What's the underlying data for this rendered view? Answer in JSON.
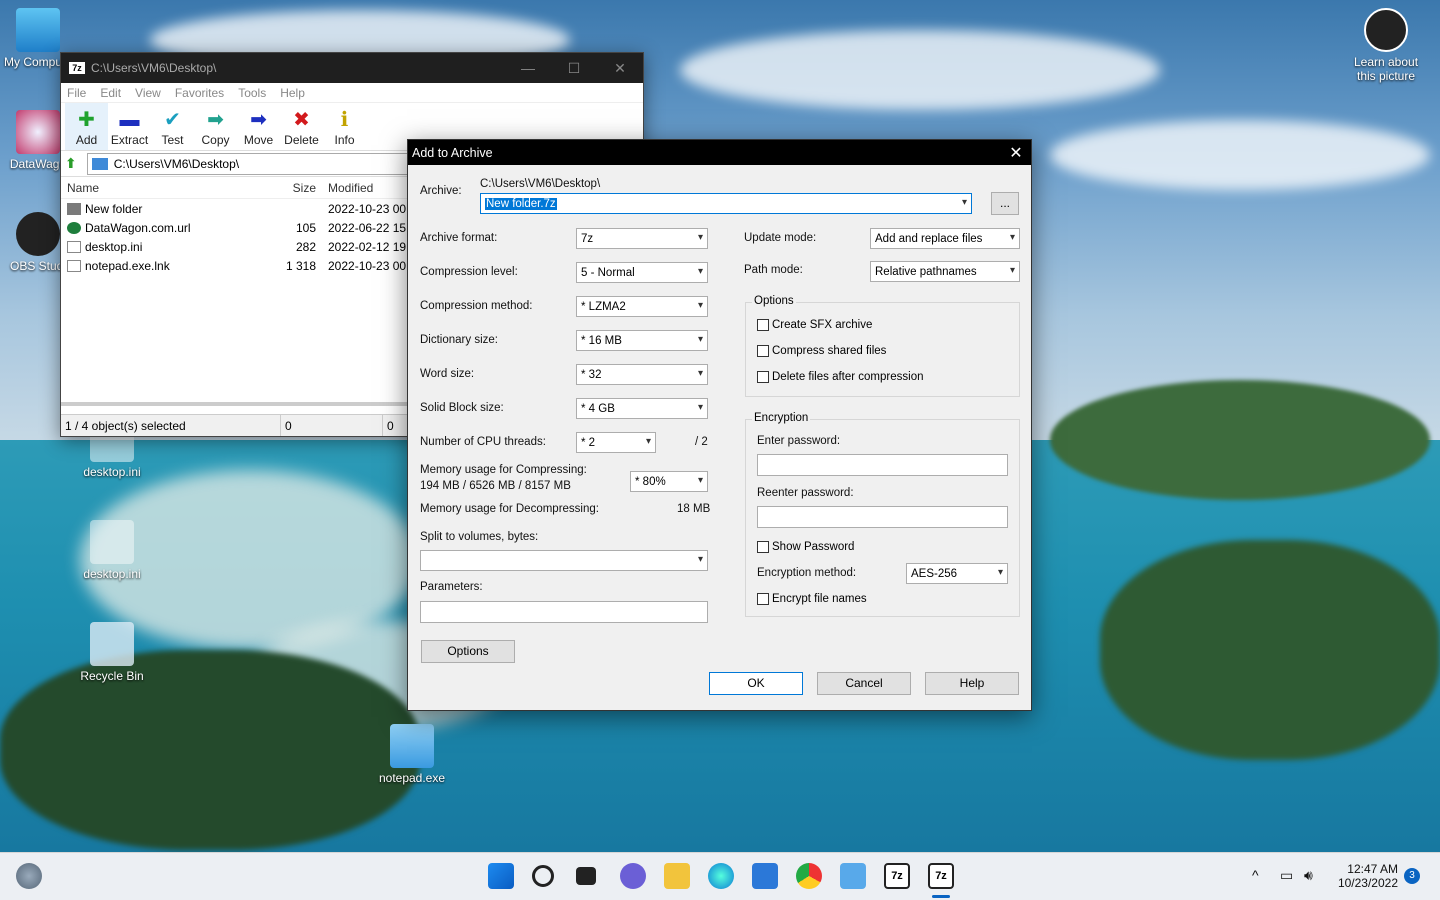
{
  "desktop": {
    "icons": [
      {
        "label": "My Compute"
      },
      {
        "label": "DataWago"
      },
      {
        "label": "OBS Studi"
      },
      {
        "label": "desktop.ini"
      },
      {
        "label": "desktop.ini"
      },
      {
        "label": "Recycle Bin"
      },
      {
        "label": "notepad.exe"
      }
    ],
    "learn_about": "Learn about this picture"
  },
  "file_manager": {
    "title": "C:\\Users\\VM6\\Desktop\\",
    "title_icon": "7z",
    "menu": [
      "File",
      "Edit",
      "View",
      "Favorites",
      "Tools",
      "Help"
    ],
    "toolbar": [
      {
        "label": "Add",
        "icon": "plus-icon",
        "color": "#1fa22e"
      },
      {
        "label": "Extract",
        "icon": "minus-icon",
        "color": "#1d2fbf"
      },
      {
        "label": "Test",
        "icon": "check-icon",
        "color": "#1b9fbf"
      },
      {
        "label": "Copy",
        "icon": "arrow-icon",
        "color": "#22a28f"
      },
      {
        "label": "Move",
        "icon": "arrow-icon",
        "color": "#1d2fbf"
      },
      {
        "label": "Delete",
        "icon": "x-icon",
        "color": "#d2191c"
      },
      {
        "label": "Info",
        "icon": "info-icon",
        "color": "#c2a300"
      }
    ],
    "address": "C:\\Users\\VM6\\Desktop\\",
    "columns": {
      "name": "Name",
      "size": "Size",
      "modified": "Modified"
    },
    "rows": [
      {
        "name": "New folder",
        "size": "",
        "modified": "2022-10-23 00:4",
        "icon": "folder-icon"
      },
      {
        "name": "DataWagon.com.url",
        "size": "105",
        "modified": "2022-06-22 15:4",
        "icon": "globe-icon"
      },
      {
        "name": "desktop.ini",
        "size": "282",
        "modified": "2022-02-12 19:0",
        "icon": "ini-file-icon"
      },
      {
        "name": "notepad.exe.lnk",
        "size": "1 318",
        "modified": "2022-10-23 00:4",
        "icon": "file-icon"
      }
    ],
    "status": {
      "selected": "1 / 4 object(s) selected",
      "size1": "0",
      "size2": "0"
    }
  },
  "dialog": {
    "title": "Add to Archive",
    "archive_label": "Archive:",
    "archive_path": "C:\\Users\\VM6\\Desktop\\",
    "archive_name": "New folder.7z",
    "browse": "...",
    "left": {
      "format_label": "Archive format:",
      "format": "7z",
      "level_label": "Compression level:",
      "level": "5 - Normal",
      "method_label": "Compression method:",
      "method": "*  LZMA2",
      "dict_label": "Dictionary size:",
      "dict": "*  16 MB",
      "word_label": "Word size:",
      "word": "*  32",
      "solid_label": "Solid Block size:",
      "solid": "*  4 GB",
      "threads_label": "Number of CPU threads:",
      "threads": "*  2",
      "threads_max": "/ 2",
      "mem_comp_label": "Memory usage for Compressing:",
      "mem_comp_value": "194 MB / 6526 MB / 8157 MB",
      "mem_pct": "* 80%",
      "mem_decomp_label": "Memory usage for Decompressing:",
      "mem_decomp": "18 MB",
      "split_label": "Split to volumes, bytes:",
      "params_label": "Parameters:",
      "options_btn": "Options"
    },
    "right": {
      "update_label": "Update mode:",
      "update": "Add and replace files",
      "path_label": "Path mode:",
      "path": "Relative pathnames",
      "options_group": "Options",
      "opt_sfx": "Create SFX archive",
      "opt_shared": "Compress shared files",
      "opt_delete": "Delete files after compression",
      "enc_group": "Encryption",
      "enter_pw": "Enter password:",
      "reenter_pw": "Reenter password:",
      "show_pw": "Show Password",
      "enc_method_label": "Encryption method:",
      "enc_method": "AES-256",
      "enc_names": "Encrypt file names"
    },
    "buttons": {
      "ok": "OK",
      "cancel": "Cancel",
      "help": "Help"
    }
  },
  "taskbar": {
    "time": "12:47 AM",
    "date": "10/23/2022",
    "notif": "3"
  }
}
